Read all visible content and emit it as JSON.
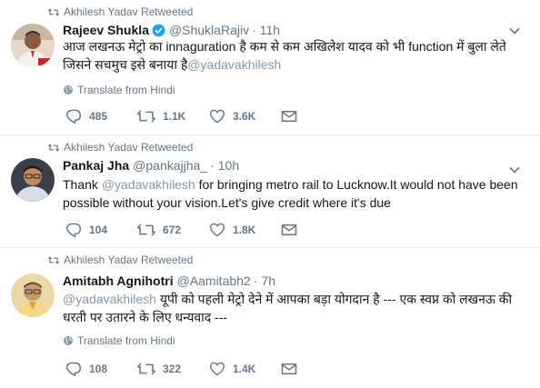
{
  "colors": {
    "text": "#14171a",
    "secondary": "#657786",
    "mention": "#8899a6",
    "verified": "#1da1f2",
    "border": "#e6ecf0"
  },
  "tweets": [
    {
      "retweet_label": "Akhilesh Yadav Retweeted",
      "name": "Rajeev Shukla",
      "verified": true,
      "handle": "@ShuklaRajiv",
      "separator": "·",
      "time": "11h",
      "text_before": "आज लखनऊ मेट्रो का innaguration है कम से कम अखिलेश यादव को भी function में बुला लेते जिसने सचमुच इसे बनाया है",
      "text_mention": "@yadavakhilesh",
      "translate": "Translate from Hindi",
      "replies": "485",
      "retweets": "1.1K",
      "likes": "3.6K",
      "avatar_icon": "person-photo"
    },
    {
      "retweet_label": "Akhilesh Yadav Retweeted",
      "name": "Pankaj Jha",
      "verified": false,
      "handle": "@pankajjha_",
      "separator": "·",
      "time": "10h",
      "text_prefix": "Thank ",
      "text_mention": "@yadavakhilesh",
      "text_after": " for bringing metro rail to Lucknow.It would not have been possible without your vision.Let's give credit where it's due",
      "replies": "104",
      "retweets": "672",
      "likes": "1.8K",
      "avatar_icon": "person-photo"
    },
    {
      "retweet_label": "Akhilesh Yadav Retweeted",
      "name": "Amitabh Agnihotri",
      "verified": false,
      "handle": "@Aamitabh2",
      "separator": "·",
      "time": "7h",
      "text_mention": "@yadavakhilesh",
      "text_after": " यूपी को पहली मेट्रो देने में आपका बड़ा योगदान है --- एक स्वप्न को लखनऊ की धरती पर उतारने के लिए धन्यवाद ---",
      "translate": "Translate from Hindi",
      "replies": "108",
      "retweets": "322",
      "likes": "1.4K",
      "avatar_icon": "person-photo"
    }
  ]
}
